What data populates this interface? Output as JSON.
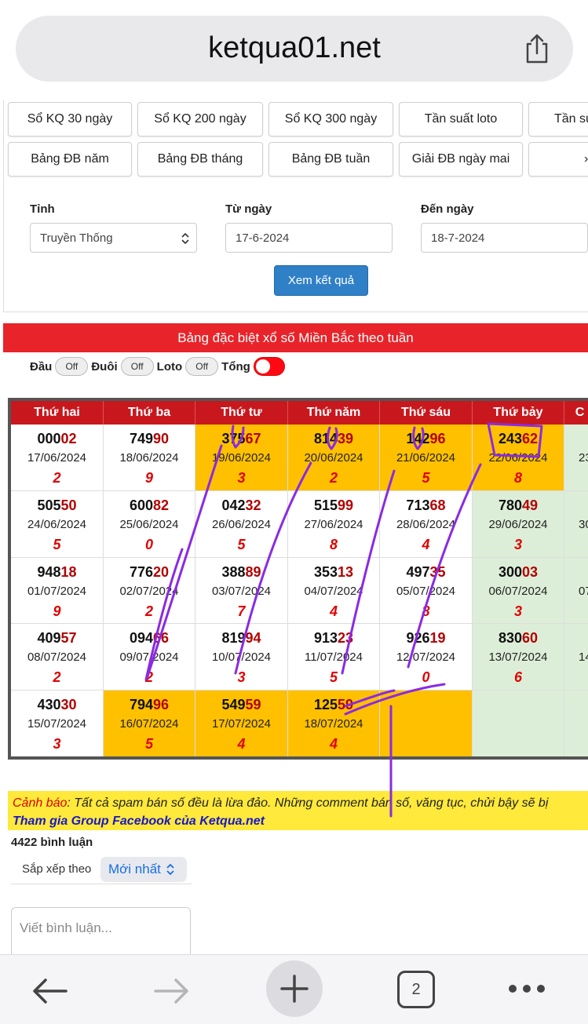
{
  "browser": {
    "url": "ketqua01.net",
    "tab_count": "2"
  },
  "links_row1": [
    "Sổ KQ 30 ngày",
    "Sổ KQ 200 ngày",
    "Sổ KQ 300 ngày",
    "Tần suất loto",
    "Tần su"
  ],
  "links_row2": [
    "Bảng ĐB năm",
    "Bảng ĐB tháng",
    "Bảng ĐB tuần",
    "Giải ĐB ngày mai",
    "›"
  ],
  "filter": {
    "province_label": "Tỉnh",
    "province_value": "Truyền Thống",
    "from_label": "Từ ngày",
    "from_value": "17-6-2024",
    "to_label": "Đến ngày",
    "to_value": "18-7-2024",
    "submit_label": "Xem kết quả"
  },
  "table_title": "Bảng đặc biệt xổ số Miền Bắc theo tuần",
  "toggles": [
    {
      "label": "Đầu",
      "state": "Off"
    },
    {
      "label": "Đuôi",
      "state": "Off"
    },
    {
      "label": "Loto",
      "state": "Off"
    },
    {
      "label": "Tổng",
      "state": "On"
    }
  ],
  "table": {
    "headers": [
      "Thứ hai",
      "Thứ ba",
      "Thứ tư",
      "Thứ năm",
      "Thứ sáu",
      "Thứ bảy",
      "C"
    ],
    "rows": [
      [
        {
          "a": "000",
          "b": "02",
          "date": "17/06/2024",
          "sum": "2"
        },
        {
          "a": "749",
          "b": "90",
          "date": "18/06/2024",
          "sum": "9"
        },
        {
          "a": "375",
          "b": "67",
          "date": "19/06/2024",
          "sum": "3",
          "hl": true
        },
        {
          "a": "814",
          "b": "39",
          "date": "20/06/2024",
          "sum": "2",
          "hl": true
        },
        {
          "a": "142",
          "b": "96",
          "date": "21/06/2024",
          "sum": "5",
          "hl": true
        },
        {
          "a": "243",
          "b": "62",
          "date": "22/06/2024",
          "sum": "8",
          "hl": true
        },
        {
          "a": "",
          "b": "",
          "date": "23",
          "sum": "",
          "gr": true
        }
      ],
      [
        {
          "a": "505",
          "b": "50",
          "date": "24/06/2024",
          "sum": "5"
        },
        {
          "a": "600",
          "b": "82",
          "date": "25/06/2024",
          "sum": "0"
        },
        {
          "a": "042",
          "b": "32",
          "date": "26/06/2024",
          "sum": "5"
        },
        {
          "a": "515",
          "b": "99",
          "date": "27/06/2024",
          "sum": "8"
        },
        {
          "a": "713",
          "b": "68",
          "date": "28/06/2024",
          "sum": "4"
        },
        {
          "a": "780",
          "b": "49",
          "date": "29/06/2024",
          "sum": "3",
          "gr": true
        },
        {
          "a": "",
          "b": "",
          "date": "30",
          "sum": "",
          "gr": true
        }
      ],
      [
        {
          "a": "948",
          "b": "18",
          "date": "01/07/2024",
          "sum": "9"
        },
        {
          "a": "776",
          "b": "20",
          "date": "02/07/2024",
          "sum": "2"
        },
        {
          "a": "388",
          "b": "89",
          "date": "03/07/2024",
          "sum": "7"
        },
        {
          "a": "353",
          "b": "13",
          "date": "04/07/2024",
          "sum": "4"
        },
        {
          "a": "497",
          "b": "35",
          "date": "05/07/2024",
          "sum": "8"
        },
        {
          "a": "300",
          "b": "03",
          "date": "06/07/2024",
          "sum": "3",
          "gr": true
        },
        {
          "a": "",
          "b": "",
          "date": "07",
          "sum": "",
          "gr": true
        }
      ],
      [
        {
          "a": "409",
          "b": "57",
          "date": "08/07/2024",
          "sum": "2"
        },
        {
          "a": "094",
          "b": "66",
          "date": "09/07/2024",
          "sum": "2"
        },
        {
          "a": "819",
          "b": "94",
          "date": "10/07/2024",
          "sum": "3"
        },
        {
          "a": "913",
          "b": "23",
          "date": "11/07/2024",
          "sum": "5"
        },
        {
          "a": "926",
          "b": "19",
          "date": "12/07/2024",
          "sum": "0"
        },
        {
          "a": "830",
          "b": "60",
          "date": "13/07/2024",
          "sum": "6",
          "gr": true
        },
        {
          "a": "",
          "b": "",
          "date": "14",
          "sum": "",
          "gr": true
        }
      ],
      [
        {
          "a": "430",
          "b": "30",
          "date": "15/07/2024",
          "sum": "3"
        },
        {
          "a": "794",
          "b": "96",
          "date": "16/07/2024",
          "sum": "5",
          "hl": true
        },
        {
          "a": "549",
          "b": "59",
          "date": "17/07/2024",
          "sum": "4",
          "hl": true
        },
        {
          "a": "125",
          "b": "59",
          "date": "18/07/2024",
          "sum": "4",
          "hl": true
        },
        {
          "a": "",
          "b": "",
          "date": "",
          "sum": "",
          "hl": true
        },
        {
          "a": "",
          "b": "",
          "date": "",
          "sum": "",
          "gr": true
        },
        {
          "a": "",
          "b": "",
          "date": "",
          "sum": "",
          "gr": true
        }
      ]
    ]
  },
  "warning": {
    "keyword": "Cảnh báo",
    "text": ": Tất cả spam bán số đều là lừa đảo. Những comment bán số, văng tục, chửi bậy sẽ bị",
    "facebook_link": "Tham gia Group Facebook của Ketqua.net"
  },
  "comments": {
    "count_label": "4422 bình luận",
    "sort_label": "Sắp xếp theo",
    "sort_value": "Mới nhất",
    "placeholder": "Viết bình luận..."
  },
  "colors": {
    "accent_red": "#e8242a",
    "highlight": "#ffc000",
    "weekend_green": "#ddeed8",
    "annotation_purple": "#8a2be2"
  }
}
